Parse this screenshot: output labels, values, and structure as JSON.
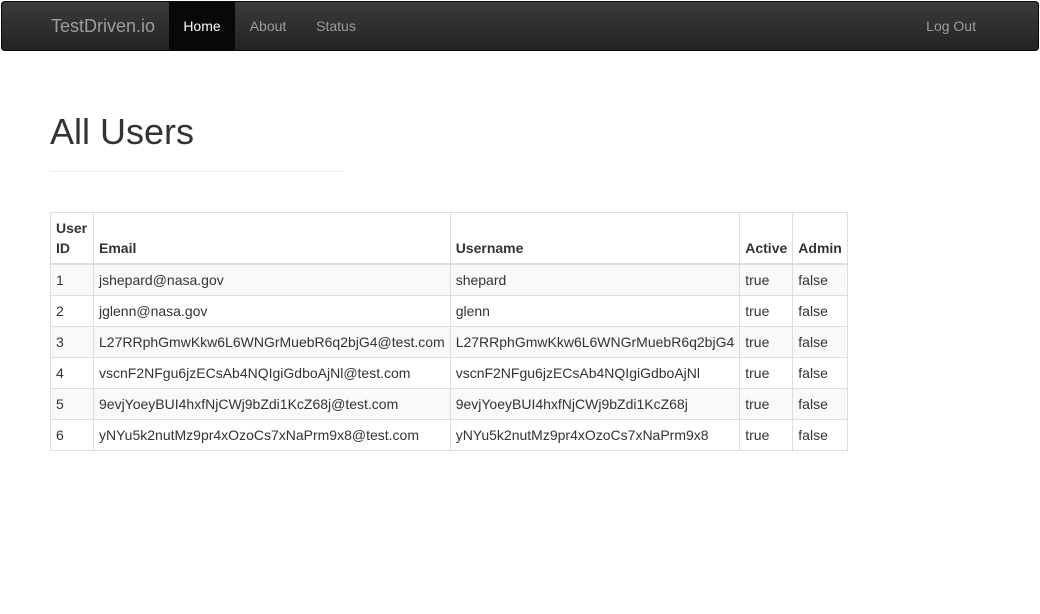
{
  "navbar": {
    "brand": "TestDriven.io",
    "items": [
      {
        "label": "Home",
        "active": true
      },
      {
        "label": "About",
        "active": false
      },
      {
        "label": "Status",
        "active": false
      }
    ],
    "logout_label": "Log Out"
  },
  "page": {
    "title": "All Users"
  },
  "table": {
    "headers": {
      "id": "User ID",
      "email": "Email",
      "username": "Username",
      "active": "Active",
      "admin": "Admin"
    },
    "rows": [
      {
        "id": "1",
        "email": "jshepard@nasa.gov",
        "username": "shepard",
        "active": "true",
        "admin": "false"
      },
      {
        "id": "2",
        "email": "jglenn@nasa.gov",
        "username": "glenn",
        "active": "true",
        "admin": "false"
      },
      {
        "id": "3",
        "email": "L27RRphGmwKkw6L6WNGrMuebR6q2bjG4@test.com",
        "username": "L27RRphGmwKkw6L6WNGrMuebR6q2bjG4",
        "active": "true",
        "admin": "false"
      },
      {
        "id": "4",
        "email": "vscnF2NFgu6jzECsAb4NQIgiGdboAjNl@test.com",
        "username": "vscnF2NFgu6jzECsAb4NQIgiGdboAjNl",
        "active": "true",
        "admin": "false"
      },
      {
        "id": "5",
        "email": "9evjYoeyBUI4hxfNjCWj9bZdi1KcZ68j@test.com",
        "username": "9evjYoeyBUI4hxfNjCWj9bZdi1KcZ68j",
        "active": "true",
        "admin": "false"
      },
      {
        "id": "6",
        "email": "yNYu5k2nutMz9pr4xOzoCs7xNaPrm9x8@test.com",
        "username": "yNYu5k2nutMz9pr4xOzoCs7xNaPrm9x8",
        "active": "true",
        "admin": "false"
      }
    ]
  },
  "colors": {
    "navbar_bg": "#222222",
    "navbar_active_bg": "#080808",
    "nav_text": "#9d9d9d",
    "nav_active_text": "#ffffff",
    "striped_row": "#f9f9f9",
    "border": "#dddddd"
  }
}
